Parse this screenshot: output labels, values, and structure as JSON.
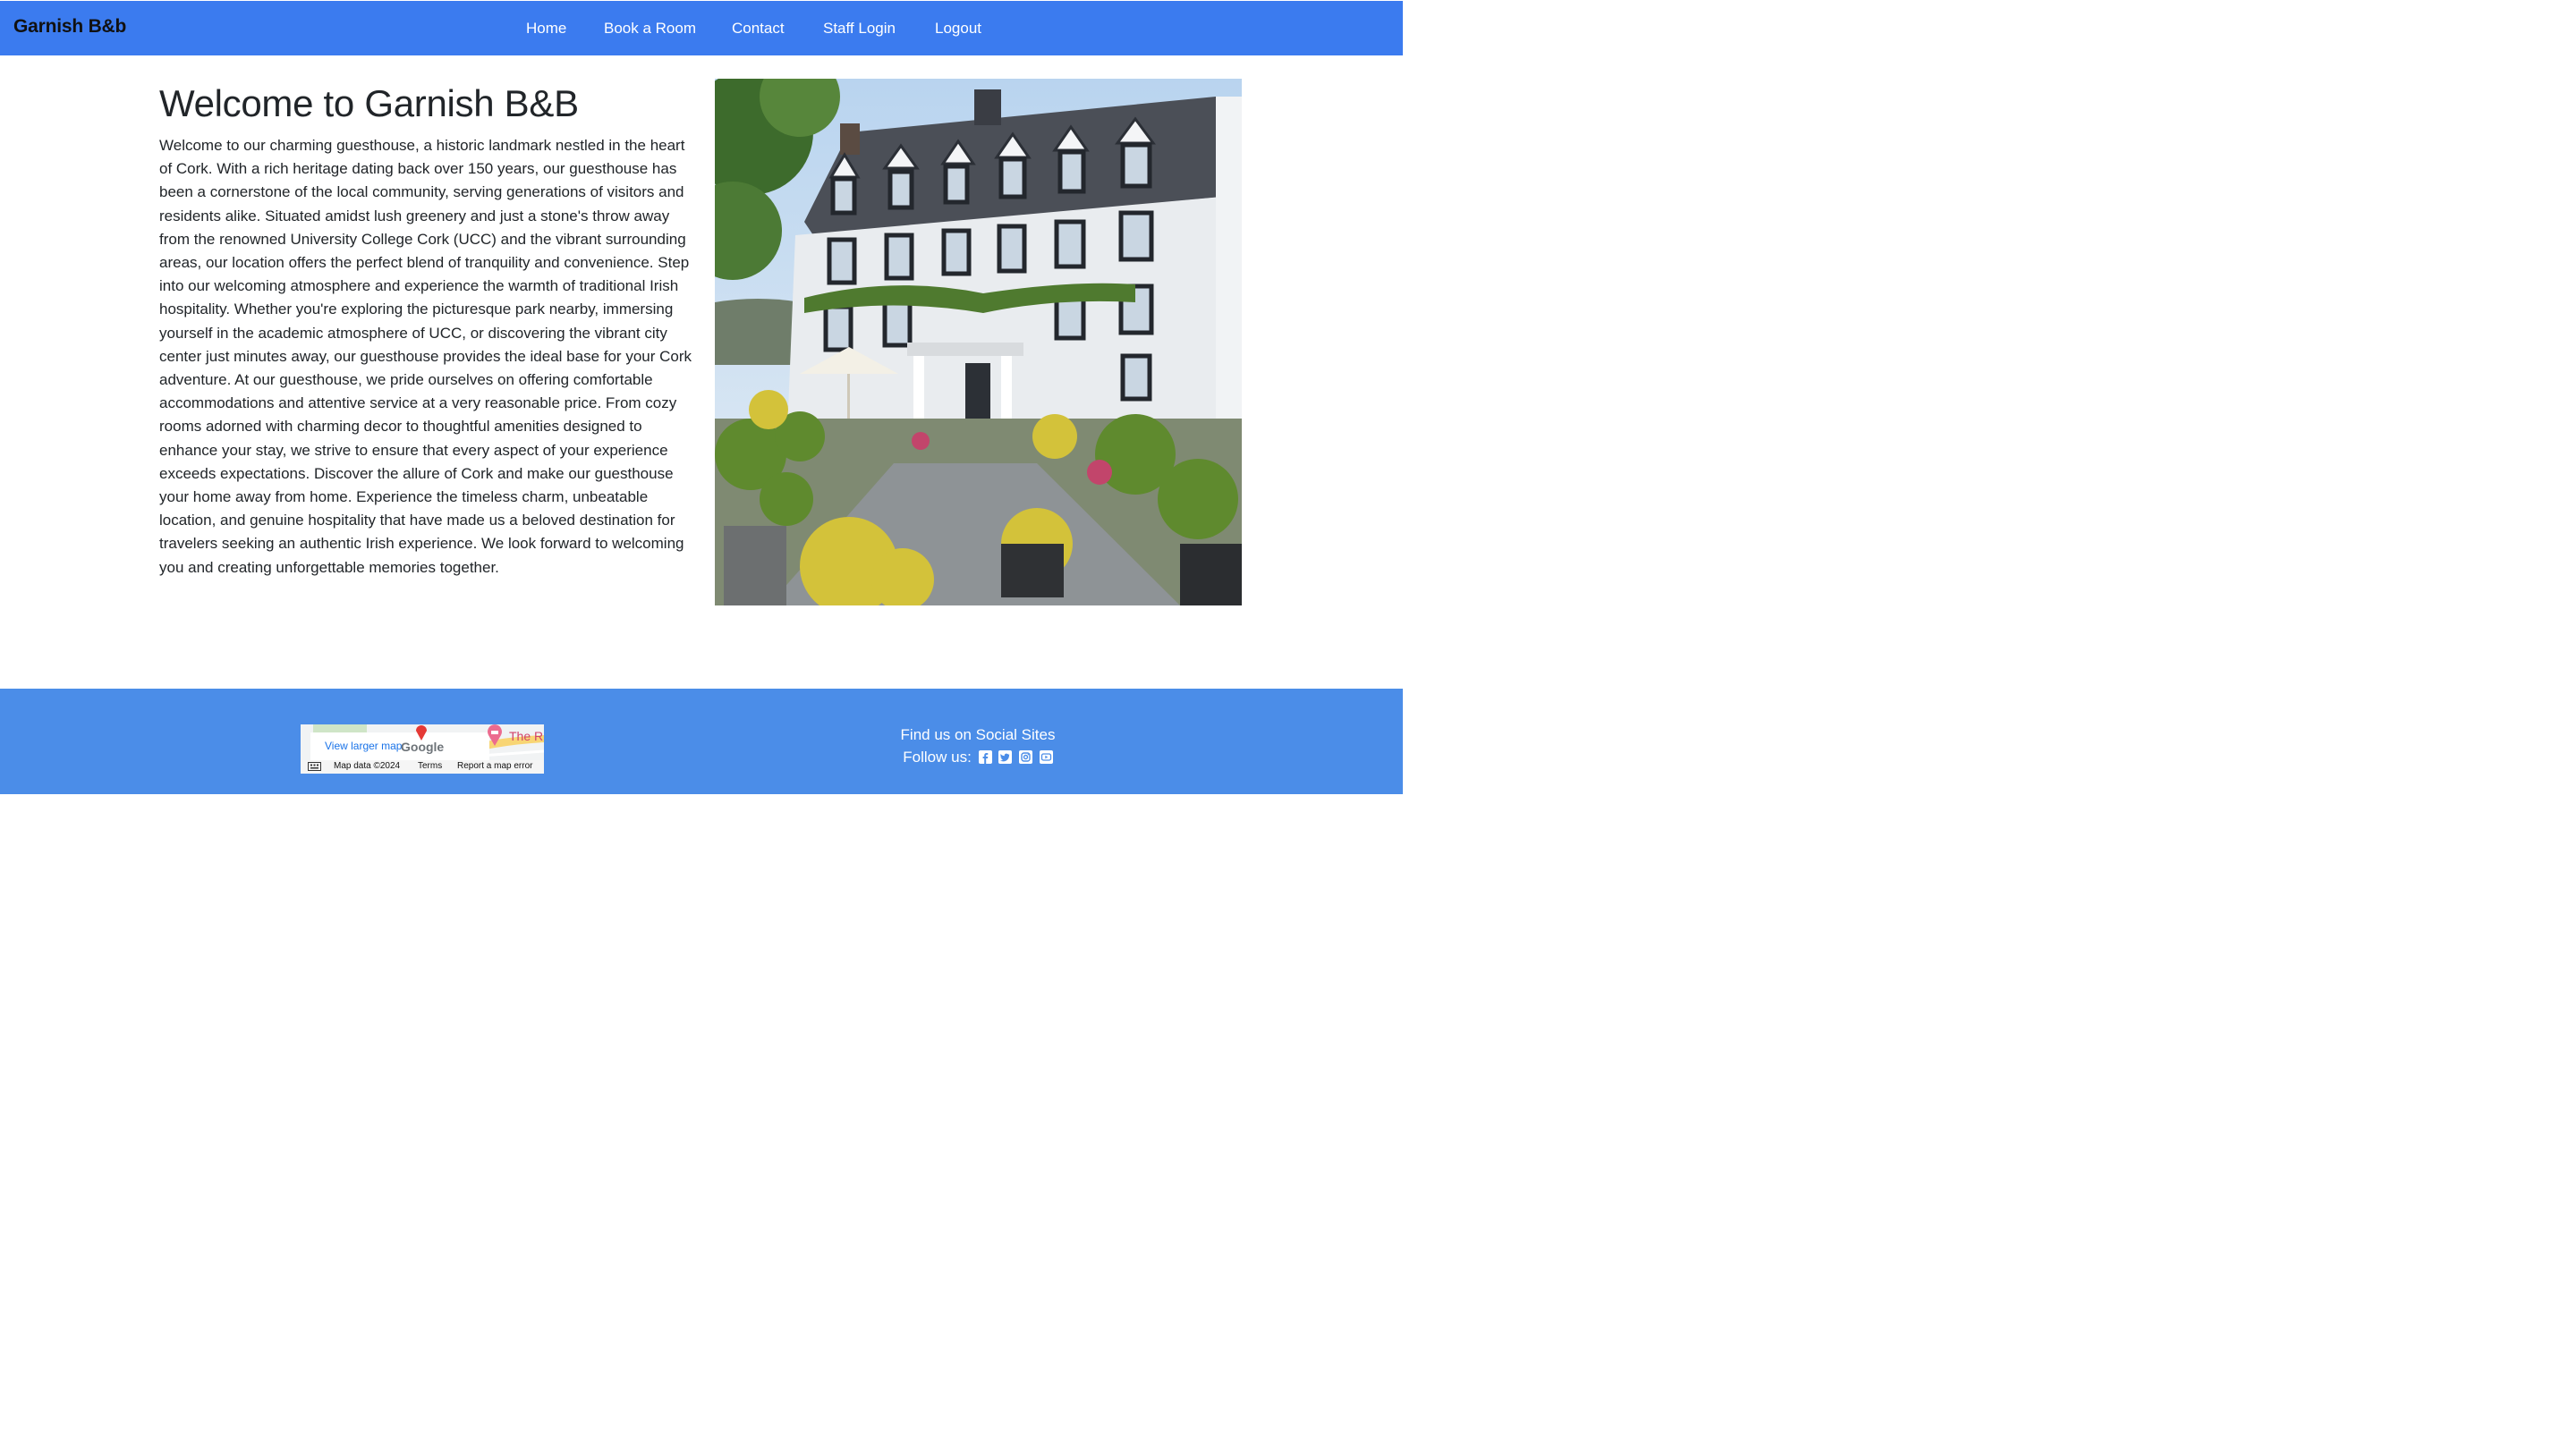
{
  "nav": {
    "brand": "Garnish B&b",
    "items": [
      {
        "label": "Home"
      },
      {
        "label": "Book a Room"
      },
      {
        "label": "Contact"
      },
      {
        "label": "Staff Login"
      },
      {
        "label": "Logout"
      }
    ]
  },
  "main": {
    "title": "Welcome to Garnish B&B",
    "intro": "Welcome to our charming guesthouse, a historic landmark nestled in the heart of Cork. With a rich heritage dating back over 150 years, our guesthouse has been a cornerstone of the local community, serving generations of visitors and residents alike. Situated amidst lush greenery and just a stone's throw away from the renowned University College Cork (UCC) and the vibrant surrounding areas, our location offers the perfect blend of tranquility and convenience. Step into our welcoming atmosphere and experience the warmth of traditional Irish hospitality. Whether you're exploring the picturesque park nearby, immersing yourself in the academic atmosphere of UCC, or discovering the vibrant city center just minutes away, our guesthouse provides the ideal base for your Cork adventure. At our guesthouse, we pride ourselves on offering comfortable accommodations and attentive service at a very reasonable price. From cozy rooms adorned with charming decor to thoughtful amenities designed to enhance your stay, we strive to ensure that every aspect of your experience exceeds expectations. Discover the allure of Cork and make our guesthouse your home away from home. Experience the timeless charm, unbeatable location, and genuine hospitality that have made us a beloved destination for travelers seeking an authentic Irish experience. We look forward to welcoming you and creating unforgettable memories together."
  },
  "footer": {
    "map": {
      "view_larger": "View larger map",
      "google": "Google",
      "place_label": "The R",
      "map_data": "Map data ©2024",
      "terms": "Terms",
      "report": "Report a map error"
    },
    "social": {
      "heading": "Find us on Social Sites",
      "follow_label": "Follow us:",
      "icons": [
        "facebook-icon",
        "twitter-icon",
        "instagram-icon",
        "youtube-icon"
      ]
    }
  },
  "colors": {
    "navbar_bg": "#3b7bef",
    "footer_bg": "#4b8de8",
    "brand_text": "#111111",
    "nav_text": "#ffffff"
  }
}
